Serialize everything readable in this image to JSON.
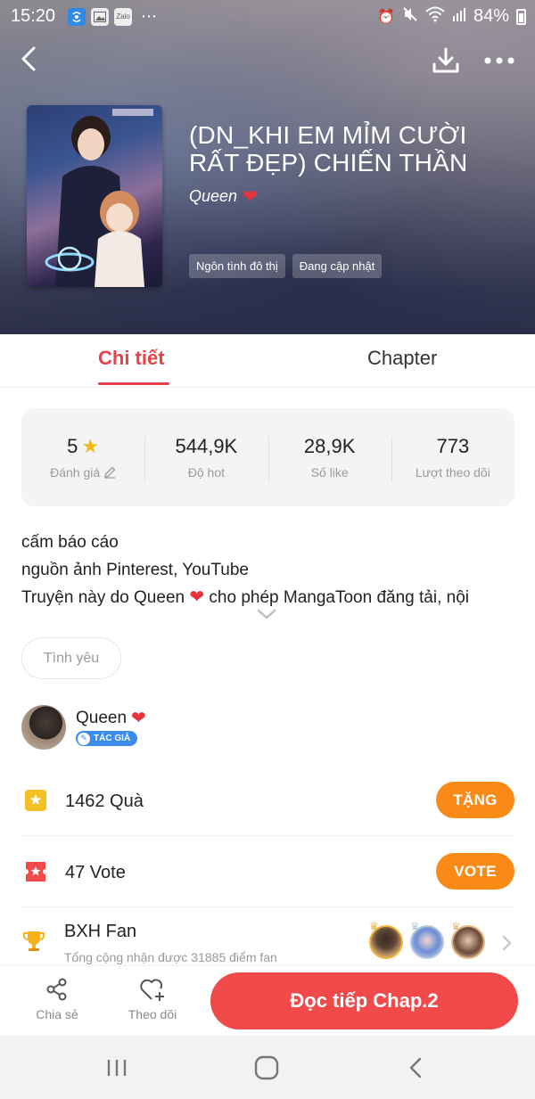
{
  "status_bar": {
    "time": "15:20",
    "battery": "84%",
    "app_icons": [
      "wifi-app-icon",
      "gallery-icon",
      "zalo-icon"
    ],
    "zalo_label": "Zalo",
    "system_icons": [
      "alarm-icon",
      "mute-icon",
      "wifi-icon",
      "signal-icon",
      "battery-icon"
    ]
  },
  "header": {
    "title": "(DN_KHI EM MỈM CƯỜI RẤT ĐẸP) CHIẾN THẦN",
    "author": "Queen",
    "tags": [
      "Ngôn tình đô thị",
      "Đang cập nhật"
    ]
  },
  "tabs": {
    "detail": "Chi tiết",
    "chapter": "Chapter",
    "active": "detail"
  },
  "stats": [
    {
      "value": "5",
      "label": "Đánh giá"
    },
    {
      "value": "544,9K",
      "label": "Độ hot"
    },
    {
      "value": "28,9K",
      "label": "Số like"
    },
    {
      "value": "773",
      "label": "Lượt theo dõi"
    }
  ],
  "description": {
    "line1": "cấm báo cáo",
    "line2": "nguồn ảnh Pinterest, YouTube",
    "line3_before": "Truyện này do Queen",
    "line3_after": "cho phép MangaToon đăng tải, nội"
  },
  "genre_pill": "Tình yêu",
  "author": {
    "name": "Queen",
    "badge": "TÁC GIẢ"
  },
  "gifts": {
    "count_text": "1462 Quà",
    "button": "TẶNG"
  },
  "votes": {
    "count_text": "47 Vote",
    "button": "VOTE"
  },
  "fan_rank": {
    "title": "BXH Fan",
    "subtitle": "Tổng cộng nhận được 31885 điểm fan"
  },
  "bottom_bar": {
    "share": "Chia sẻ",
    "follow": "Theo dõi",
    "read": "Đọc tiếp Chap.2"
  },
  "colors": {
    "accent_red": "#e8414a",
    "read_button": "#f04a4a",
    "orange_button": "#f98a17",
    "star": "#f6b821",
    "badge_blue": "#3a8bea"
  }
}
